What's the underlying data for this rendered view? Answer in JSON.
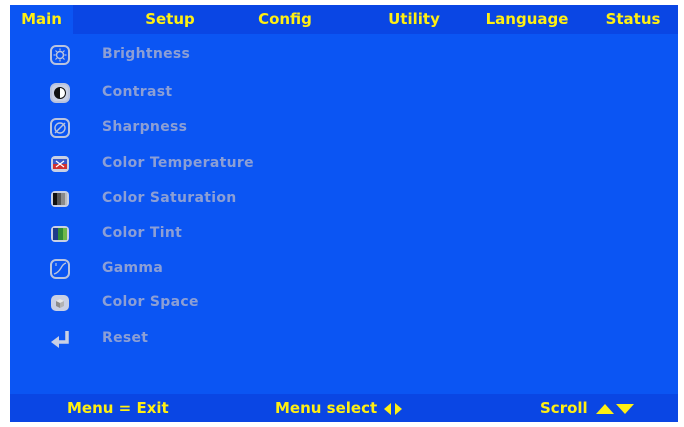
{
  "tabs": [
    {
      "label": "Main"
    },
    {
      "label": "Setup"
    },
    {
      "label": "Config"
    },
    {
      "label": "Utility"
    },
    {
      "label": "Language"
    },
    {
      "label": "Status"
    }
  ],
  "menu": [
    {
      "label": "Brightness"
    },
    {
      "label": "Contrast"
    },
    {
      "label": "Sharpness"
    },
    {
      "label": "Color Temperature"
    },
    {
      "label": "Color Saturation"
    },
    {
      "label": "Color Tint"
    },
    {
      "label": "Gamma"
    },
    {
      "label": "Color Space"
    },
    {
      "label": "Reset"
    }
  ],
  "footer": {
    "exit": "Menu = Exit",
    "select": "Menu select",
    "scroll": "Scroll"
  },
  "colors": {
    "background": "#0b55f3",
    "bar": "#0a46e4",
    "tab_text": "#ffef12",
    "item_text": "#8c9fd5"
  }
}
